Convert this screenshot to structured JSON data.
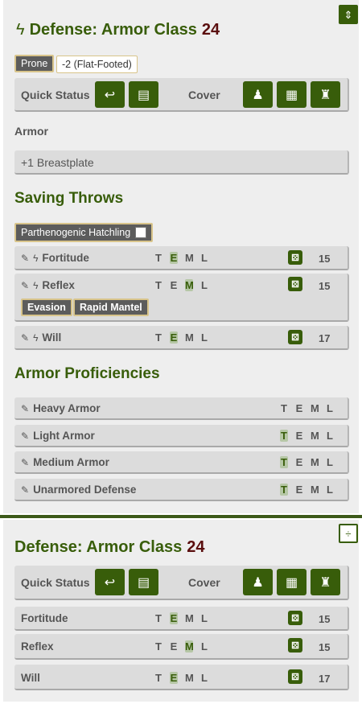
{
  "colors": {
    "accent": "#385d0a",
    "ac_value": "#5a0e0e",
    "tag_border": "#d8c48a"
  },
  "panel1": {
    "collapse_icon": "collapse-vertical-icon",
    "title": "Defense: Armor Class",
    "ac": "24",
    "conditions": [
      {
        "label": "Prone"
      },
      {
        "label": "-2 (Flat-Footed)"
      }
    ],
    "quick_status_label": "Quick Status",
    "cover_label": "Cover",
    "armor_label": "Armor",
    "armor_value": "+1 Breastplate",
    "saving_throws_title": "Saving Throws",
    "save_feature": "Parthenogenic Hatchling",
    "saves": [
      {
        "name": "Fortitude",
        "prof": [
          "T",
          "E",
          "M",
          "L"
        ],
        "active": "E",
        "value": "15"
      },
      {
        "name": "Reflex",
        "prof": [
          "T",
          "E",
          "M",
          "L"
        ],
        "active": "M",
        "value": "15",
        "features": [
          "Evasion",
          "Rapid Mantel"
        ]
      },
      {
        "name": "Will",
        "prof": [
          "T",
          "E",
          "M",
          "L"
        ],
        "active": "E",
        "value": "17"
      }
    ],
    "armor_prof_title": "Armor Proficiencies",
    "armor_profs": [
      {
        "name": "Heavy Armor",
        "prof": [
          "T",
          "E",
          "M",
          "L"
        ],
        "active": ""
      },
      {
        "name": "Light Armor",
        "prof": [
          "T",
          "E",
          "M",
          "L"
        ],
        "active": "T"
      },
      {
        "name": "Medium Armor",
        "prof": [
          "T",
          "E",
          "M",
          "L"
        ],
        "active": "T"
      },
      {
        "name": "Unarmored Defense",
        "prof": [
          "T",
          "E",
          "M",
          "L"
        ],
        "active": "T"
      }
    ]
  },
  "panel2": {
    "expand_icon": "expand-vertical-icon",
    "title": "Defense: Armor Class",
    "ac": "24",
    "quick_status_label": "Quick Status",
    "cover_label": "Cover",
    "saves": [
      {
        "name": "Fortitude",
        "prof": [
          "T",
          "E",
          "M",
          "L"
        ],
        "active": "E",
        "value": "15"
      },
      {
        "name": "Reflex",
        "prof": [
          "T",
          "E",
          "M",
          "L"
        ],
        "active": "M",
        "value": "15"
      },
      {
        "name": "Will",
        "prof": [
          "T",
          "E",
          "M",
          "L"
        ],
        "active": "E",
        "value": "17"
      }
    ]
  }
}
